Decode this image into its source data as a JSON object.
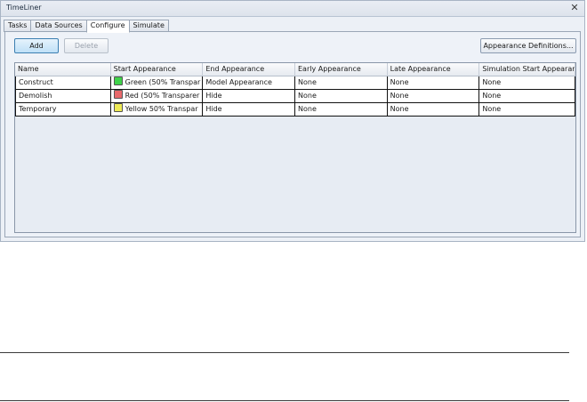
{
  "window": {
    "title": "TimeLiner",
    "close_glyph": "✕"
  },
  "tabs": [
    {
      "label": "Tasks",
      "active": false
    },
    {
      "label": "Data Sources",
      "active": false
    },
    {
      "label": "Configure",
      "active": true
    },
    {
      "label": "Simulate",
      "active": false
    }
  ],
  "toolbar": {
    "add_label": "Add",
    "delete_label": "Delete",
    "appearance_defs_label": "Appearance Definitions..."
  },
  "table": {
    "columns": [
      "Name",
      "Start Appearance",
      "End Appearance",
      "Early Appearance",
      "Late Appearance",
      "Simulation Start Appearar"
    ],
    "rows": [
      {
        "name": "Construct",
        "start": "Green (50% Transpar",
        "start_color": "#3fd24a",
        "end": "Model Appearance",
        "early": "None",
        "late": "None",
        "sim_start": "None"
      },
      {
        "name": "Demolish",
        "start": "Red (50% Transparer",
        "start_color": "#e8696b",
        "end": "Hide",
        "early": "None",
        "late": "None",
        "sim_start": "None"
      },
      {
        "name": "Temporary",
        "start": "Yellow 50% Transpar",
        "start_color": "#eeea55",
        "end": "Hide",
        "early": "None",
        "late": "None",
        "sim_start": "None"
      }
    ]
  }
}
